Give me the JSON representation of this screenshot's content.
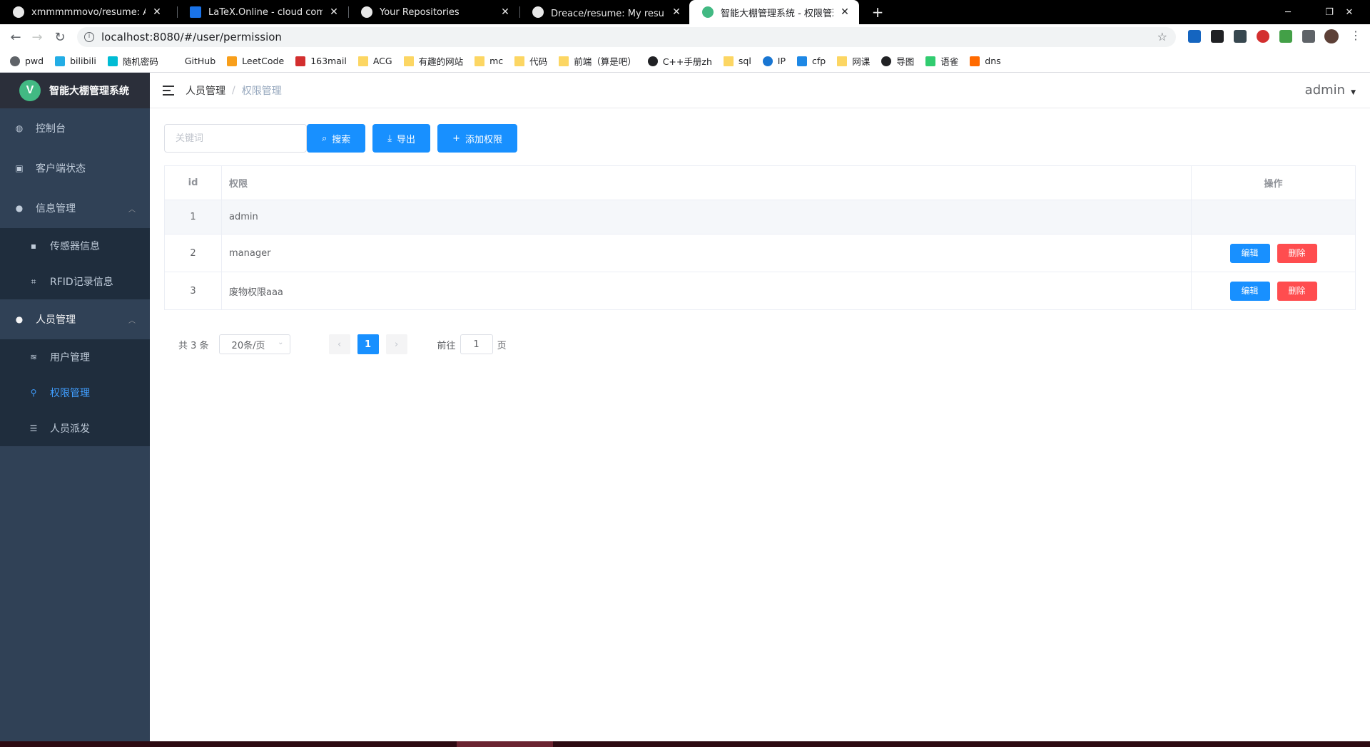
{
  "browser": {
    "tabs": [
      {
        "title": "xmmmmmovo/resume: An ele",
        "icon": "github-icon",
        "active": false
      },
      {
        "title": "LaTeX.Online - cloud compiler",
        "icon": "latex-icon",
        "active": false
      },
      {
        "title": "Your Repositories",
        "icon": "github-icon",
        "active": false
      },
      {
        "title": "Dreace/resume: My resume/个",
        "icon": "github-icon",
        "active": false
      },
      {
        "title": "智能大棚管理系统 - 权限管理",
        "icon": "vue-icon",
        "active": true
      }
    ],
    "new_tab_label": "+",
    "url": "localhost:8080/#/user/permission",
    "bookmarks": [
      {
        "label": "pwd",
        "icon": "gear-icon"
      },
      {
        "label": "bilibili",
        "icon": "bilibili-icon"
      },
      {
        "label": "随机密码",
        "icon": "key-icon"
      },
      {
        "label": "GitHub",
        "icon": "github-icon"
      },
      {
        "label": "LeetCode",
        "icon": "leetcode-icon"
      },
      {
        "label": "163mail",
        "icon": "mail-icon"
      },
      {
        "label": "ACG",
        "icon": "folder-icon"
      },
      {
        "label": "有趣的网站",
        "icon": "folder-icon"
      },
      {
        "label": "mc",
        "icon": "folder-icon"
      },
      {
        "label": "代码",
        "icon": "folder-icon"
      },
      {
        "label": "前端（算是吧）",
        "icon": "folder-icon"
      },
      {
        "label": "C++手册zh",
        "icon": "cpp-icon"
      },
      {
        "label": "sql",
        "icon": "folder-icon"
      },
      {
        "label": "IP",
        "icon": "globe-icon"
      },
      {
        "label": "cfp",
        "icon": "chart-icon"
      },
      {
        "label": "网课",
        "icon": "folder-icon"
      },
      {
        "label": "导图",
        "icon": "owl-icon"
      },
      {
        "label": "语雀",
        "icon": "yuque-icon"
      },
      {
        "label": "dns",
        "icon": "dns-icon"
      }
    ]
  },
  "sidebar": {
    "logo_letter": "V",
    "title": "智能大棚管理系统",
    "items": [
      {
        "label": "控制台",
        "icon": "dashboard-icon"
      },
      {
        "label": "客户端状态",
        "icon": "client-icon"
      },
      {
        "label": "信息管理",
        "icon": "info-icon",
        "arrow": "︿"
      },
      {
        "label": "传感器信息",
        "icon": "sensor-icon"
      },
      {
        "label": "RFID记录信息",
        "icon": "rfid-icon"
      },
      {
        "label": "人员管理",
        "icon": "user-icon",
        "arrow": "︿"
      },
      {
        "label": "用户管理",
        "icon": "layers-icon"
      },
      {
        "label": "权限管理",
        "icon": "key-icon"
      },
      {
        "label": "人员派发",
        "icon": "clipboard-icon"
      }
    ]
  },
  "header": {
    "breadcrumb": [
      "人员管理",
      "权限管理"
    ],
    "breadcrumb_sep": "/",
    "user_name": "admin"
  },
  "toolbar": {
    "search_placeholder": "关键词",
    "search_label": "搜索",
    "export_label": "导出",
    "add_label": "添加权限"
  },
  "table": {
    "columns": [
      "id",
      "权限",
      "操作"
    ],
    "rows": [
      {
        "id": "1",
        "name": "admin"
      },
      {
        "id": "2",
        "name": "manager"
      },
      {
        "id": "3",
        "name": "废物权限aaa"
      }
    ],
    "edit_label": "编辑",
    "delete_label": "删除"
  },
  "pagination": {
    "total_text": "共 3 条",
    "page_size": "20条/页",
    "current_page": "1",
    "goto_prefix": "前往",
    "goto_value": "1",
    "goto_suffix": "页"
  },
  "colors": {
    "sidebar_bg": "#304156",
    "submenu_bg": "#1f2d3d",
    "primary": "#1890ff",
    "danger": "#ff4d4f",
    "active_menu": "#409eff"
  }
}
